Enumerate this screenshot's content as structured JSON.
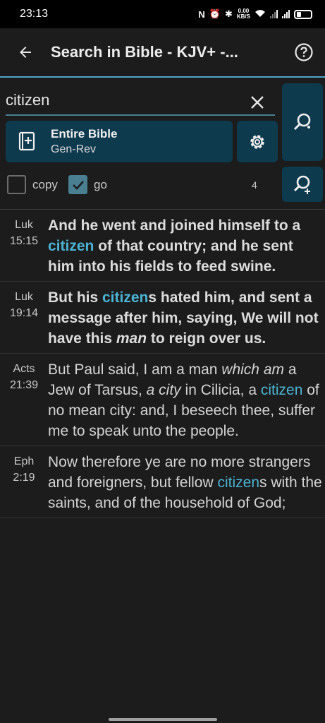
{
  "status_bar": {
    "time": "23:13",
    "netspeed_value": "0.00",
    "netspeed_unit": "KB/S"
  },
  "app_bar": {
    "title": "Search in Bible - KJV+ -..."
  },
  "search": {
    "value": "citizen"
  },
  "scope": {
    "title": "Entire Bible",
    "range": "Gen-Rev"
  },
  "options": {
    "copy_label": "copy",
    "copy_checked": false,
    "go_label": "go",
    "go_checked": true,
    "result_count": "4"
  },
  "colors": {
    "accent": "#4fa6c6",
    "button_bg": "#0e3a4e",
    "highlight": "#4bb3d3",
    "background": "#1c1c1c"
  },
  "icons": {
    "back": "arrow-left-icon",
    "help": "question-circle-icon",
    "clear": "close-icon",
    "scope": "book-add-icon",
    "settings": "gear-icon",
    "search": "search-icon",
    "search_refine": "search-refine-icon"
  },
  "results": [
    {
      "book": "Luk",
      "chapter_verse": "15:15",
      "bold": true,
      "segments": [
        {
          "text": "And he went and joined himself to a "
        },
        {
          "text": "citizen",
          "style": "hl"
        },
        {
          "text": " of that country; and he sent him into his fields to feed swine."
        }
      ]
    },
    {
      "book": "Luk",
      "chapter_verse": "19:14",
      "bold": true,
      "segments": [
        {
          "text": "But his "
        },
        {
          "text": "citizen",
          "style": "hl"
        },
        {
          "text": "s hated him, and sent a message after him, saying, We will not have this "
        },
        {
          "text": "man",
          "style": "it"
        },
        {
          "text": " to reign over us."
        }
      ]
    },
    {
      "book": "Acts",
      "chapter_verse": "21:39",
      "bold": false,
      "segments": [
        {
          "text": "But Paul said, I am a man "
        },
        {
          "text": "which am",
          "style": "it"
        },
        {
          "text": " a Jew of Tarsus, "
        },
        {
          "text": "a city",
          "style": "it"
        },
        {
          "text": " in Cilicia, a "
        },
        {
          "text": "citizen",
          "style": "hl"
        },
        {
          "text": " of no mean city: and, I beseech thee, suffer me to speak unto the people."
        }
      ]
    },
    {
      "book": "Eph",
      "chapter_verse": "2:19",
      "bold": false,
      "segments": [
        {
          "text": "Now therefore ye are no more strangers and foreigners, but fellow "
        },
        {
          "text": "citizen",
          "style": "hl"
        },
        {
          "text": "s with the saints, and of the household of God;"
        }
      ]
    }
  ]
}
